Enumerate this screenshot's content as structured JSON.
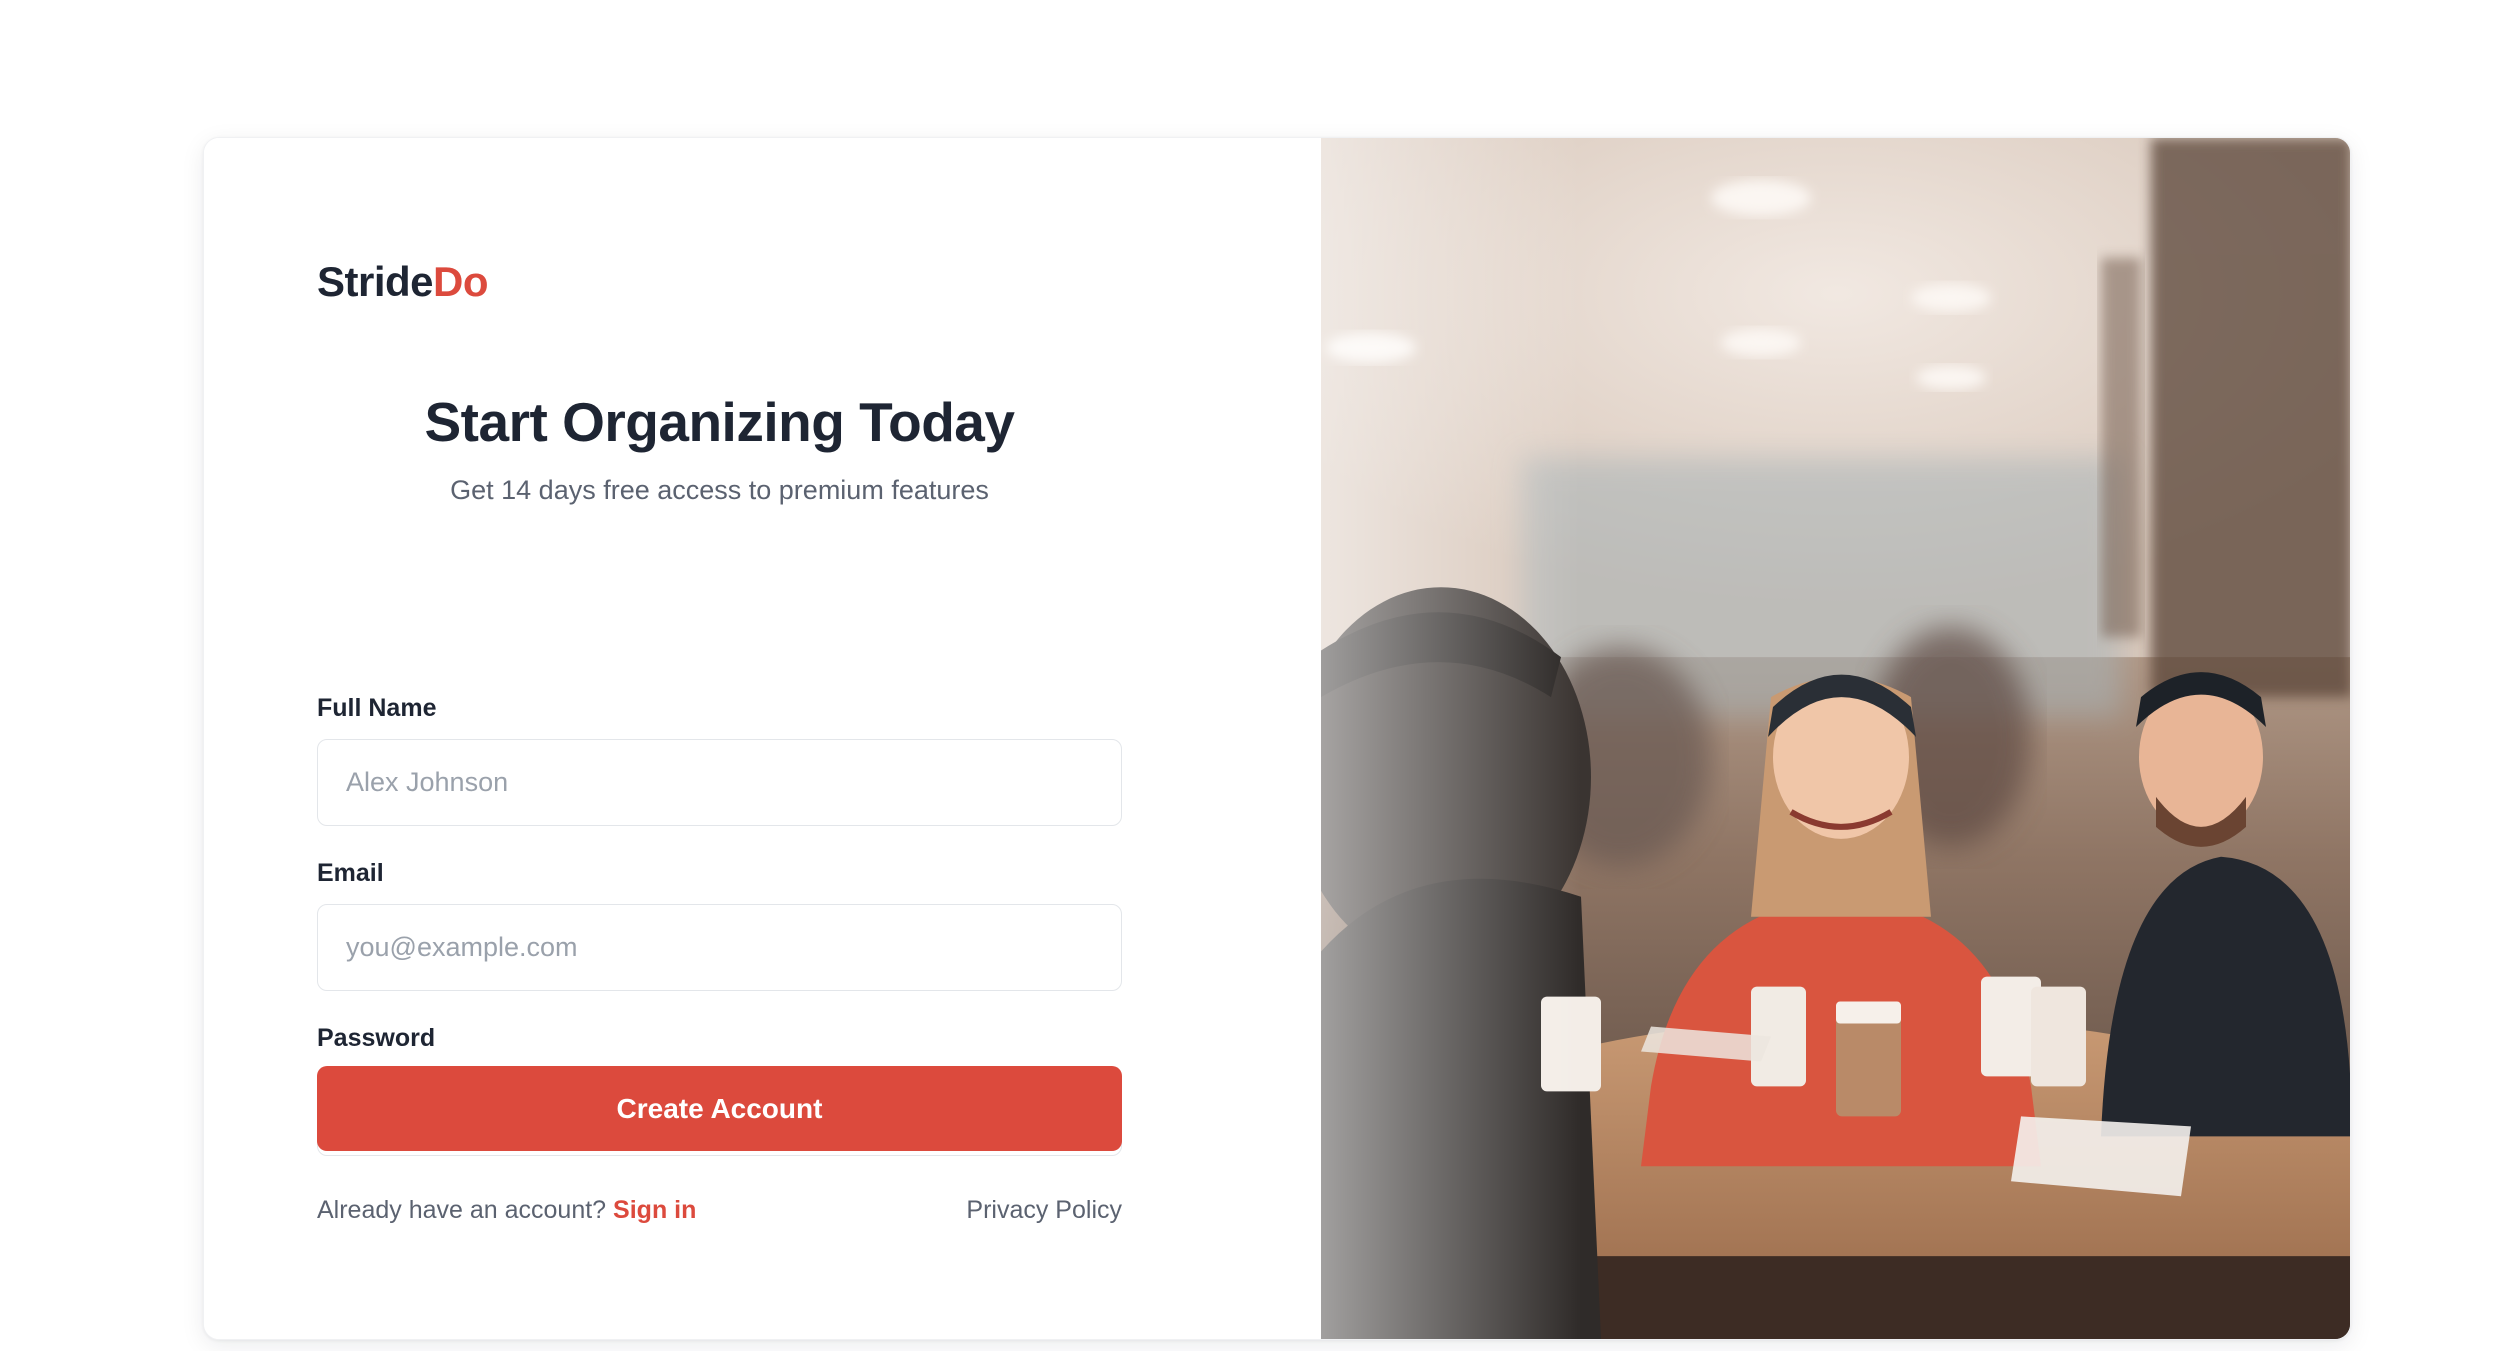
{
  "brand": {
    "name_part1": "Stride",
    "name_part2": "Do",
    "accent_color": "#dc4a3d"
  },
  "hero": {
    "title": "Start Organizing Today",
    "subtitle": "Get 14 days free access to premium features"
  },
  "form": {
    "full_name": {
      "label": "Full Name",
      "placeholder": "Alex Johnson",
      "value": ""
    },
    "email": {
      "label": "Email",
      "placeholder": "you@example.com",
      "value": ""
    },
    "password": {
      "label": "Password",
      "placeholder": "••••••••",
      "value": ""
    },
    "submit_label": "Create Account"
  },
  "footer": {
    "signin_prompt": "Already have an account?",
    "signin_link": "Sign in",
    "privacy_link": "Privacy Policy"
  },
  "image": {
    "subject": "friends-laughing-at-cafe-table-photo"
  }
}
